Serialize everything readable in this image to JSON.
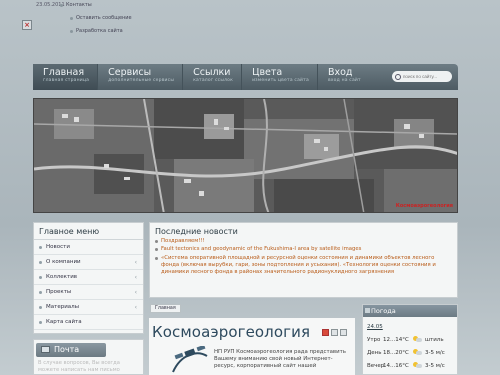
{
  "top": {
    "date": "23.05.2011",
    "contacts": "Контакты",
    "leave_message": "Оставить сообщение",
    "developers": "Разработка сайта"
  },
  "nav": {
    "items": [
      {
        "title": "Главная",
        "subtitle": "главная страница"
      },
      {
        "title": "Сервисы",
        "subtitle": "дополнительные сервисы"
      },
      {
        "title": "Ссылки",
        "subtitle": "каталог ссылок"
      },
      {
        "title": "Цвета",
        "subtitle": "изменить цвета сайта"
      },
      {
        "title": "Вход",
        "subtitle": "вход на сайт"
      }
    ],
    "search_placeholder": "поиск по сайту..."
  },
  "banner": {
    "caption": "Космоаэрогеология"
  },
  "menu": {
    "title": "Главное меню",
    "items": [
      "Новости",
      "О компании",
      "Коллектив",
      "Проекты",
      "Материалы",
      "Карта сайта"
    ]
  },
  "news": {
    "title": "Последние новости",
    "items": [
      "Поздравляем!!!",
      "Fault tectonics and geodynamic of the Fukushima-I area by satellite images",
      "«Система оперативной площадной и ресурсной оценки состояния и динамики объектов лесного фонда (включая вырубки, гари, зоны подтопления и усыхания). «Технология оценки состояния и динамики лесного фонда в районах значительного радионуклидного загрязнения"
    ]
  },
  "breadcrumb": "Главная",
  "article": {
    "title": "Космоаэрогеология",
    "text": "НП РУП Космоаэрогеология рада представить Вашему вниманию свой новый Интернет-ресурс, корпоративный сайт нашей"
  },
  "weather": {
    "title": "Погода",
    "date": "24.05",
    "rows": [
      {
        "period": "Утро",
        "temp": "12...14°C",
        "wind": "штиль"
      },
      {
        "period": "День",
        "temp": "18...20°C",
        "wind": "3-5 м/с"
      },
      {
        "period": "Вечер",
        "temp": "14...16°C",
        "wind": "3-5 м/с"
      }
    ]
  },
  "mail": {
    "title": "Почта",
    "text": "В случае вопросов, Вы всегда можете написать нам письмо"
  }
}
